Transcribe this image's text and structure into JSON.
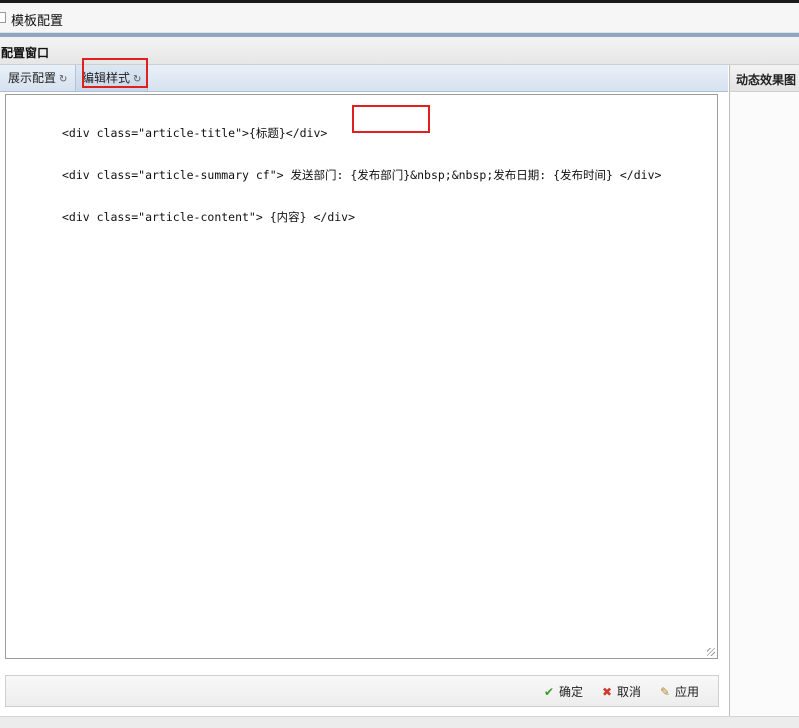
{
  "window": {
    "title": "模板配置"
  },
  "panel": {
    "title": "配置窗口"
  },
  "tabs": [
    {
      "label": "展示配置"
    },
    {
      "label": "编辑样式"
    }
  ],
  "side_panel": {
    "title": "动态效果图"
  },
  "editor": {
    "lines": [
      "<div class=\"article-title\">{标题}</div>",
      "<div class=\"article-summary cf\"> 发送部门: {发布部门}&nbsp;&nbsp;发布日期: {发布时间} </div>",
      "<div class=\"article-content\"> {内容} </div>"
    ]
  },
  "buttons": {
    "ok": "确定",
    "cancel": "取消",
    "apply": "应用"
  },
  "colors": {
    "highlight": "#e0201f",
    "accent": "#8fa7c4"
  }
}
